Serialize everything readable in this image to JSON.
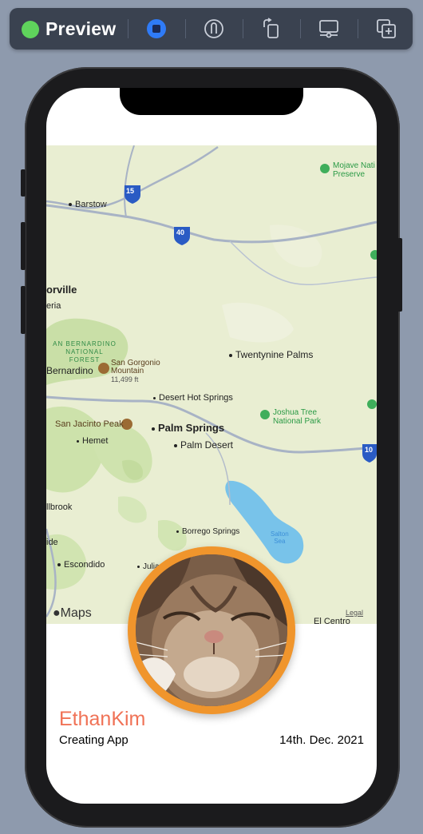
{
  "toolbar": {
    "title": "Preview",
    "status_color": "#5fd35c",
    "buttons": [
      {
        "name": "live-mode-button",
        "icon": "live-square-icon",
        "active": true
      },
      {
        "name": "selectable-mode-button",
        "icon": "pointer-tap-icon"
      },
      {
        "name": "rotate-device-button",
        "icon": "rotate-icon"
      },
      {
        "name": "device-settings-button",
        "icon": "device-settings-icon"
      },
      {
        "name": "duplicate-preview-button",
        "icon": "add-preview-icon"
      }
    ]
  },
  "map": {
    "attribution": "Maps",
    "legal": "Legal",
    "labels": {
      "barstow": "Barstow",
      "mojave_1": "Mojave Nati",
      "mojave_2": "Preserve",
      "victorville": "orville",
      "hesperia": "eria",
      "forest_1": "AN BERNARDINO",
      "forest_2": "NATIONAL",
      "forest_3": "FOREST",
      "san_bernardino": "Bernardino",
      "san_gorgonio_1": "San Gorgonio",
      "san_gorgonio_2": "Mountain",
      "san_gorgonio_3": "11,499 ft",
      "twentynine_palms": "Twentynine Palms",
      "desert_hot_springs": "Desert Hot Springs",
      "joshua_tree_1": "Joshua Tree",
      "joshua_tree_2": "National Park",
      "san_jacinto": "San Jacinto Peak",
      "palm_springs": "Palm Springs",
      "palm_desert": "Palm Desert",
      "hemet": "Hemet",
      "fallbrook": "llbrook",
      "oceanside": "ide",
      "escondido": "Escondido",
      "borrego": "Borrego Springs",
      "salton_1": "Salton",
      "salton_2": "Sea",
      "julian": "Julia",
      "el_centro": "El Centro",
      "route_15": "15",
      "route_40": "40",
      "route_10": "10"
    }
  },
  "profile": {
    "name": "EthanKim",
    "role": "Creating App",
    "date": "14th. Dec. 2021"
  }
}
